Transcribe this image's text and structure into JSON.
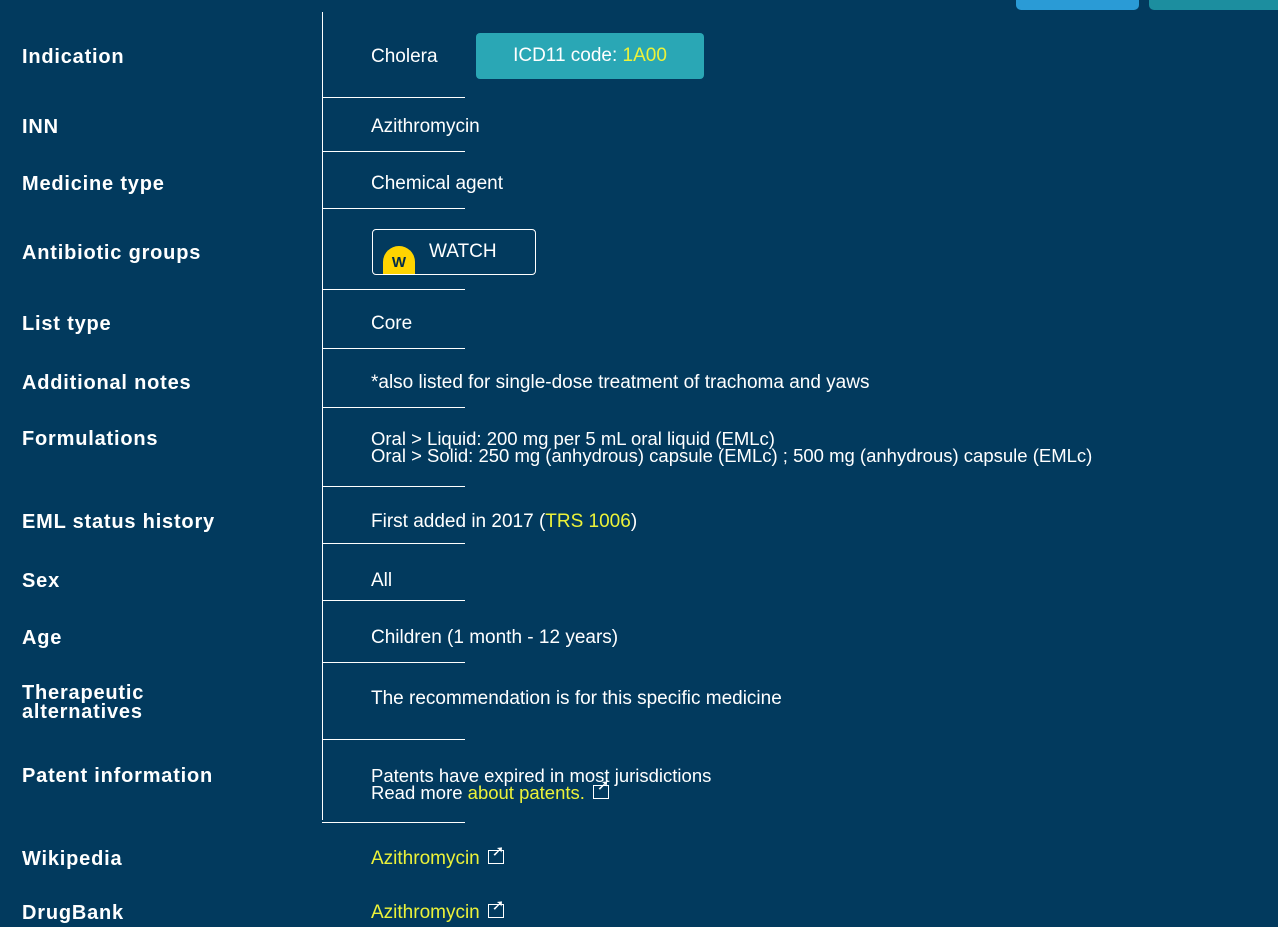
{
  "rows": {
    "indication": {
      "label": "Indication",
      "value": "Cholera",
      "icd_prefix": "ICD11 code: ",
      "icd_code": "1A00"
    },
    "inn": {
      "label": "INN",
      "value": "Azithromycin"
    },
    "medicine_type": {
      "label": "Medicine type",
      "value": "Chemical agent"
    },
    "antibiotic_groups": {
      "label": "Antibiotic groups",
      "badge_letter": "W",
      "badge_text": "WATCH",
      "badge_color": "#ffd400"
    },
    "list_type": {
      "label": "List type",
      "value": "Core"
    },
    "additional_notes": {
      "label": "Additional notes",
      "value": "*also listed for single-dose treatment of trachoma and yaws"
    },
    "formulations": {
      "label": "Formulations",
      "line1": "Oral > Liquid: 200 mg per 5 mL oral liquid (EMLc)",
      "line2": "Oral > Solid: 250 mg (anhydrous) capsule (EMLc) ; 500 mg (anhydrous) capsule (EMLc)"
    },
    "eml_status": {
      "label": "EML status history",
      "prefix": "First added in 2017 (",
      "link": "TRS 1006",
      "suffix": ")"
    },
    "sex": {
      "label": "Sex",
      "value": "All"
    },
    "age": {
      "label": "Age",
      "value": "Children (1 month - 12 years)"
    },
    "therapeutic_alternatives": {
      "label_line1": "Therapeutic",
      "label_line2": "alternatives",
      "value": "The recommendation is for this specific medicine"
    },
    "patent_information": {
      "label": "Patent information",
      "line1": "Patents have expired in most jurisdictions",
      "line2_prefix": "Read more ",
      "link": "about patents.",
      "link_icon": "external-link-icon"
    },
    "wikipedia": {
      "label": "Wikipedia",
      "link": "Azithromycin",
      "link_icon": "external-link-icon"
    },
    "drugbank": {
      "label": "DrugBank",
      "link": "Azithromycin",
      "link_icon": "external-link-icon"
    }
  },
  "colors": {
    "background": "#023a5e",
    "link": "#ecf239",
    "icd_badge": "#2aa7b5"
  }
}
